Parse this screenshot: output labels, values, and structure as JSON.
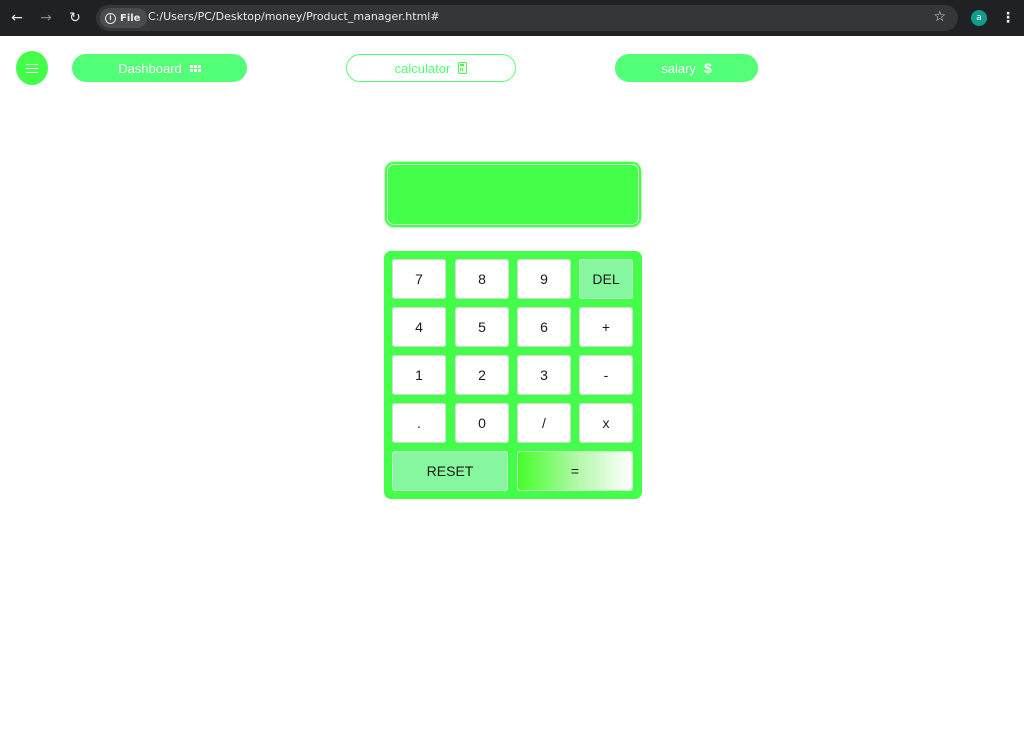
{
  "browser": {
    "file_chip_label": "File",
    "url": "C:/Users/PC/Desktop/money/Product_manager.html#",
    "profile_initial": "a"
  },
  "nav": {
    "dashboard_label": "Dashboard",
    "calculator_label": "calculator",
    "salary_label": "salary",
    "accent_color": "#44ff4a"
  },
  "calculator": {
    "display_value": "",
    "keys": {
      "k7": "7",
      "k8": "8",
      "k9": "9",
      "del": "DEL",
      "k4": "4",
      "k5": "5",
      "k6": "6",
      "plus": "+",
      "k1": "1",
      "k2": "2",
      "k3": "3",
      "minus": "-",
      "dot": ".",
      "k0": "0",
      "divide": "/",
      "multiply": "x",
      "reset": "RESET",
      "equals": "="
    }
  }
}
